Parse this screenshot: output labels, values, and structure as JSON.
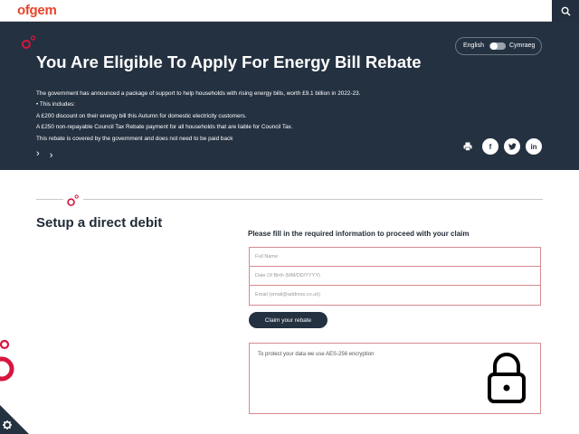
{
  "header": {
    "logo": "ofgem",
    "search_icon": "search-icon"
  },
  "hero": {
    "title": "You Are Eligible To Apply For Energy Bill Rebate",
    "language": {
      "english": "English",
      "welsh": "Cymraeg"
    },
    "body_lines": [
      "The government has announced a package of support to help households with rising energy bills, worth £9.1 billion in 2022-23.",
      "• This includes:",
      "A £200 discount on their energy bill this Autumn for domestic electricity customers.",
      "A £250 non-repayable Council Tax Rebate payment for all households that are liable for Council Tax.",
      "This rebate is covered by the government and does not need to be paid back"
    ],
    "chevron_1": "›",
    "chevron_2": "›",
    "share": {
      "facebook": "f",
      "twitter": "t",
      "linkedin": "in"
    }
  },
  "main": {
    "section_title": "Setup a direct debit",
    "form_heading": "Please fill in the required information to proceed with your claim",
    "fields": {
      "full_name_placeholder": "Full Name",
      "dob_placeholder": "Date Of Birth (MM/DD/YYYY)",
      "email_placeholder": "Email (email@address.co.uk)"
    },
    "claim_button": "Claim your rebate",
    "secure_text": "To protect your data we use AES-256 encryption"
  },
  "colors": {
    "brand_red": "#e8442a",
    "navy": "#243141",
    "field_border": "#d48a8f",
    "accent_pink": "#d6163f"
  }
}
